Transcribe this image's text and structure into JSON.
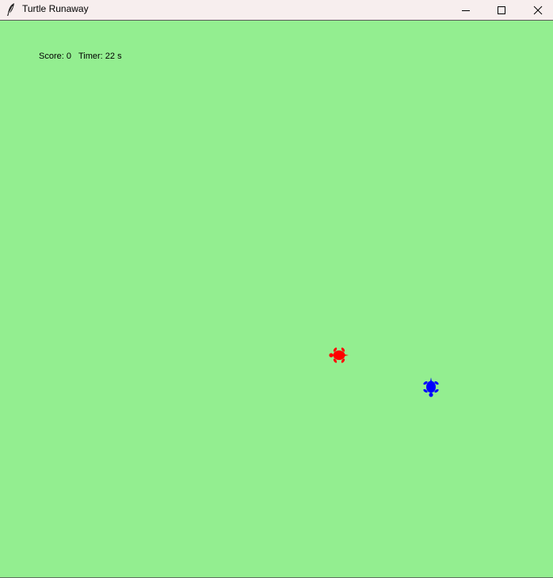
{
  "window": {
    "title": "Turtle Runaway",
    "app_icon": "feather-icon",
    "controls": {
      "minimize": "minimize-icon",
      "maximize": "maximize-icon",
      "close": "close-icon"
    }
  },
  "hud": {
    "score_label": "Score:",
    "score_value": "0",
    "timer_label": "Timer:",
    "timer_value": "22",
    "timer_unit": "s"
  },
  "game": {
    "background_color": "#93ee90",
    "runner": {
      "name": "red turtle",
      "color": "#ff0000",
      "heading_deg": 180
    },
    "chaser": {
      "name": "blue turtle",
      "color": "#0000ff",
      "heading_deg": 270
    }
  }
}
